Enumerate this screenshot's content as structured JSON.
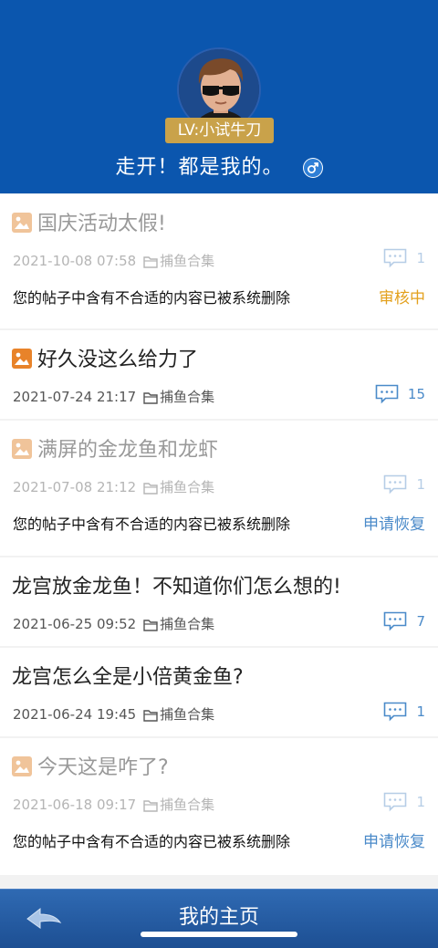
{
  "profile": {
    "level": "LV:小试牛刀",
    "username": "走开！都是我的。",
    "gender_icon": "male-icon"
  },
  "posts": [
    {
      "title": "国庆活动太假!",
      "has_image": true,
      "date": "2021-10-08 07:58",
      "board": "捕鱼合集",
      "comment_count": "1",
      "deleted": true,
      "notice": "您的帖子中含有不合适的内容已被系统删除",
      "status": "审核中",
      "status_color": "#e3a01c"
    },
    {
      "title": "好久没这么给力了",
      "has_image": true,
      "date": "2021-07-24 21:17",
      "board": "捕鱼合集",
      "comment_count": "15",
      "deleted": false
    },
    {
      "title": "满屏的金龙鱼和龙虾",
      "has_image": true,
      "date": "2021-07-08 21:12",
      "board": "捕鱼合集",
      "comment_count": "1",
      "deleted": true,
      "notice": "您的帖子中含有不合适的内容已被系统删除",
      "status": "申请恢复",
      "status_color": "#4a8ac9"
    },
    {
      "title": "龙宫放金龙鱼！不知道你们怎么想的!",
      "has_image": false,
      "date": "2021-06-25 09:52",
      "board": "捕鱼合集",
      "comment_count": "7",
      "deleted": false
    },
    {
      "title": "龙宫怎么全是小倍黄金鱼?",
      "has_image": false,
      "date": "2021-06-24 19:45",
      "board": "捕鱼合集",
      "comment_count": "1",
      "deleted": false
    },
    {
      "title": "今天这是咋了?",
      "has_image": true,
      "date": "2021-06-18 09:17",
      "board": "捕鱼合集",
      "comment_count": "1",
      "deleted": true,
      "notice": "您的帖子中含有不合适的内容已被系统删除",
      "status": "申请恢复",
      "status_color": "#4a8ac9"
    }
  ],
  "bottom_bar": {
    "title": "我的主页",
    "back_icon": "back-arrow-icon"
  },
  "colors": {
    "header": "#0b56ae",
    "accent": "#4a8ac9",
    "level_badge": "#c9a24a",
    "image_icon_active": "#e8832a",
    "image_icon_faded": "#f0c49a"
  }
}
